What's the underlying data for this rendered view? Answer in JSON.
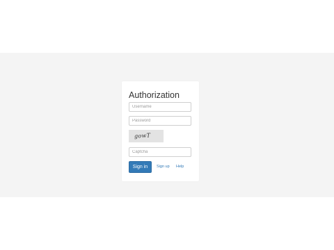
{
  "login": {
    "title": "Authorization",
    "username_placeholder": "Username",
    "password_placeholder": "Password",
    "captcha_text": "gowT",
    "captcha_placeholder": "Captcha",
    "signin_label": "Sign in",
    "signup_label": "Sign up",
    "help_label": "Help"
  },
  "colors": {
    "background": "#f4f4f4",
    "card": "#ffffff",
    "primary": "#337ab7",
    "link": "#337ab7"
  }
}
